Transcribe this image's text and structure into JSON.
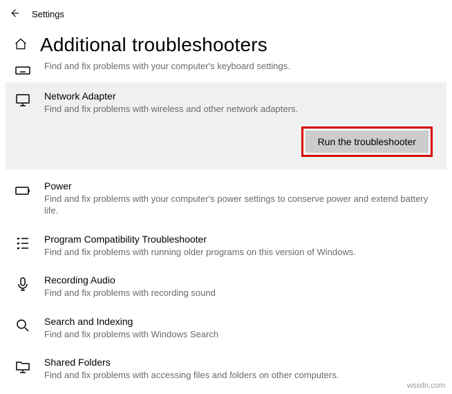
{
  "header": {
    "title": "Settings"
  },
  "page": {
    "title": "Additional troubleshooters"
  },
  "partial_top_desc": "Find and fix problems with your computer's keyboard settings.",
  "selected": {
    "title": "Network Adapter",
    "desc": "Find and fix problems with wireless and other network adapters.",
    "run_button": "Run the troubleshooter"
  },
  "items": [
    {
      "title": "Power",
      "desc": "Find and fix problems with your computer's power settings to conserve power and extend battery life."
    },
    {
      "title": "Program Compatibility Troubleshooter",
      "desc": "Find and fix problems with running older programs on this version of Windows."
    },
    {
      "title": "Recording Audio",
      "desc": "Find and fix problems with recording sound"
    },
    {
      "title": "Search and Indexing",
      "desc": "Find and fix problems with Windows Search"
    },
    {
      "title": "Shared Folders",
      "desc": "Find and fix problems with accessing files and folders on other computers."
    }
  ],
  "watermark": "wsxdn.com"
}
